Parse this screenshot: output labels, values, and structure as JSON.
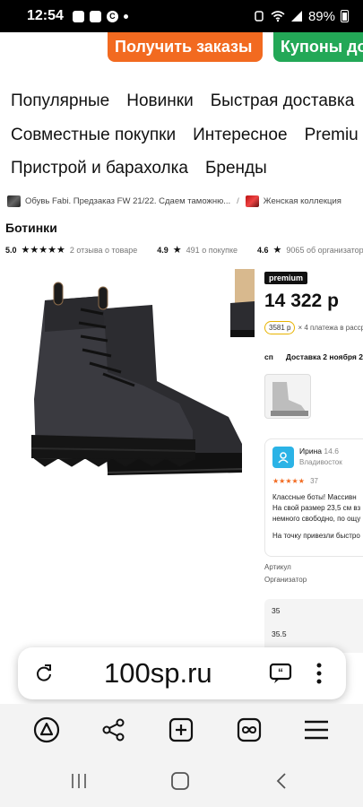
{
  "status_bar": {
    "time": "12:54",
    "battery": "89%"
  },
  "promo": {
    "orders_label": "Получить заказы",
    "coupons_label": "Купоны до"
  },
  "menu": {
    "row1": [
      "Популярные",
      "Новинки",
      "Быстрая доставка"
    ],
    "row2": [
      "Совместные покупки",
      "Интересное",
      "Premiu"
    ],
    "row3": [
      "Пристрой и барахолка",
      "Бренды"
    ]
  },
  "breadcrumb": {
    "item1": "Обувь Fabi. Предзаказ FW 21/22. Сдаем таможню...",
    "separator": "/",
    "item2": "Женская коллекция"
  },
  "product": {
    "title": "Ботинки",
    "rating1_value": "5.0",
    "rating1_text": "2 отзыва о товаре",
    "rating2_value": "4.9",
    "rating2_text": "491 о покупке",
    "rating3_value": "4.6",
    "rating3_text": "9065 об организаторе",
    "premium_badge": "premium",
    "price": "14 322 р",
    "installment_amount": "3581 р",
    "installment_text": "× 4 платежа в расср",
    "delivery_col1": "сп",
    "delivery_col2": "Доставка 2 ноября 202"
  },
  "review": {
    "name": "Ирина",
    "score": "14.6",
    "city": "Владивосток",
    "count": "37",
    "line1": "Классные боты! Массивн",
    "line2": "На свой размер 23,5 см вз",
    "line3": "немного свободно, по ощу",
    "line4": "На точку привезли быстро"
  },
  "specs": {
    "article_label": "Артикул",
    "organizer_label": "Организатор"
  },
  "sizes": [
    "35",
    "35.5"
  ],
  "browser": {
    "url": "100sp.ru"
  },
  "colors": {
    "orange": "#f26a20",
    "green": "#23a857",
    "avatar_blue": "#2bb3e6"
  }
}
